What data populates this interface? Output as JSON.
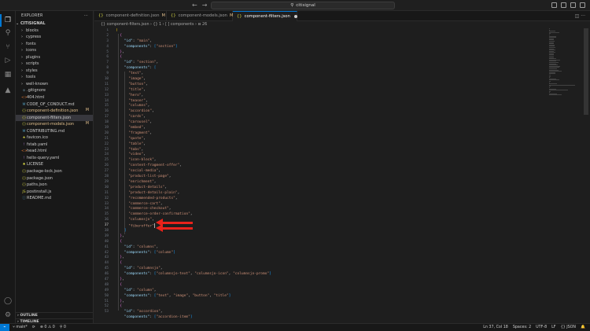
{
  "titlebar": {
    "back_icon": "arrow-left-icon",
    "forward_icon": "arrow-right-icon",
    "search_text": "citisignal"
  },
  "sidebar": {
    "title": "EXPLORER",
    "more": "···",
    "root": "CITISIGNAL",
    "items": [
      {
        "label": "blocks",
        "type": "folder"
      },
      {
        "label": "cypress",
        "type": "folder"
      },
      {
        "label": "fonts",
        "type": "folder"
      },
      {
        "label": "icons",
        "type": "folder"
      },
      {
        "label": "plugins",
        "type": "folder"
      },
      {
        "label": "scripts",
        "type": "folder"
      },
      {
        "label": "styles",
        "type": "folder"
      },
      {
        "label": "tools",
        "type": "folder"
      },
      {
        "label": "well-known",
        "type": "folder"
      },
      {
        "label": ".gitignore",
        "type": "file",
        "icon": "◆"
      },
      {
        "label": "404.html",
        "type": "file",
        "icon": "<>"
      },
      {
        "label": "CODE_OF_CONDUCT.md",
        "type": "file",
        "icon": "M"
      },
      {
        "label": "component-definition.json",
        "type": "file",
        "icon": "{}",
        "badge": "M"
      },
      {
        "label": "component-filters.json",
        "type": "file",
        "icon": "{}",
        "selected": true
      },
      {
        "label": "component-models.json",
        "type": "file",
        "icon": "{}",
        "badge": "M"
      },
      {
        "label": "CONTRIBUTING.md",
        "type": "file",
        "icon": "M"
      },
      {
        "label": "favicon.ico",
        "type": "file",
        "icon": "★"
      },
      {
        "label": "fstab.yaml",
        "type": "file",
        "icon": "!"
      },
      {
        "label": "head.html",
        "type": "file",
        "icon": "<>"
      },
      {
        "label": "helix-query.yaml",
        "type": "file",
        "icon": "!"
      },
      {
        "label": "LICENSE",
        "type": "file",
        "icon": "♠"
      },
      {
        "label": "package-lock.json",
        "type": "file",
        "icon": "{}"
      },
      {
        "label": "package.json",
        "type": "file",
        "icon": "{}"
      },
      {
        "label": "paths.json",
        "type": "file",
        "icon": "{}"
      },
      {
        "label": "postinstall.js",
        "type": "file",
        "icon": "JS"
      },
      {
        "label": "README.md",
        "type": "file",
        "icon": "ⓘ"
      }
    ],
    "outline": "OUTLINE",
    "timeline": "TIMELINE"
  },
  "tabs": [
    {
      "label": "component-definition.json",
      "status": "M"
    },
    {
      "label": "component-models.json",
      "status": "M"
    },
    {
      "label": "component-filters.json",
      "status": "",
      "active": true,
      "dirty": true
    }
  ],
  "breadcrumb": "{} component-filters.json  ›  {} 1  ›  [ ] components  ›  ⊟ 26",
  "editor": {
    "line_numbers": [
      "1",
      "2",
      "3",
      "4",
      "5",
      "6",
      "7",
      "8",
      "9",
      "10",
      "11",
      "12",
      "13",
      "14",
      "15",
      "16",
      "17",
      "18",
      "19",
      "20",
      "21",
      "22",
      "23",
      "24",
      "25",
      "26",
      "27",
      "28",
      "29",
      "30",
      "31",
      "32",
      "33",
      "34",
      "35",
      "36",
      "37",
      "38",
      "39",
      "40",
      "41",
      "42",
      "43",
      "44",
      "45",
      "46",
      "47",
      "48",
      "49",
      "50",
      "51",
      "52",
      "53"
    ],
    "lines": [
      [
        [
          "b1",
          "["
        ]
      ],
      [
        [
          "p",
          "  "
        ],
        [
          "b2",
          "{"
        ]
      ],
      [
        [
          "p",
          "    "
        ],
        [
          "k",
          "\"id\""
        ],
        [
          "p",
          ": "
        ],
        [
          "s",
          "\"main\""
        ],
        [
          "p",
          ","
        ]
      ],
      [
        [
          "p",
          "    "
        ],
        [
          "k",
          "\"components\""
        ],
        [
          "p",
          ": "
        ],
        [
          "b3",
          "["
        ],
        [
          "s",
          "\"section\""
        ],
        [
          "b3",
          "]"
        ]
      ],
      [
        [
          "p",
          "  "
        ],
        [
          "b2",
          "}"
        ],
        [
          "p",
          ","
        ]
      ],
      [
        [
          "p",
          "  "
        ],
        [
          "b2",
          "{"
        ]
      ],
      [
        [
          "p",
          "    "
        ],
        [
          "k",
          "\"id\""
        ],
        [
          "p",
          ": "
        ],
        [
          "s",
          "\"section\""
        ],
        [
          "p",
          ","
        ]
      ],
      [
        [
          "p",
          "    "
        ],
        [
          "k",
          "\"components\""
        ],
        [
          "p",
          ": "
        ],
        [
          "b3",
          "["
        ]
      ],
      [
        [
          "p",
          "      "
        ],
        [
          "s",
          "\"text\""
        ],
        [
          "p",
          ","
        ]
      ],
      [
        [
          "p",
          "      "
        ],
        [
          "s",
          "\"image\""
        ],
        [
          "p",
          ","
        ]
      ],
      [
        [
          "p",
          "      "
        ],
        [
          "s",
          "\"button\""
        ],
        [
          "p",
          ","
        ]
      ],
      [
        [
          "p",
          "      "
        ],
        [
          "s",
          "\"title\""
        ],
        [
          "p",
          ","
        ]
      ],
      [
        [
          "p",
          "      "
        ],
        [
          "s",
          "\"hero\""
        ],
        [
          "p",
          ","
        ]
      ],
      [
        [
          "p",
          "      "
        ],
        [
          "s",
          "\"teaser\""
        ],
        [
          "p",
          ","
        ]
      ],
      [
        [
          "p",
          "      "
        ],
        [
          "s",
          "\"columns\""
        ],
        [
          "p",
          ","
        ]
      ],
      [
        [
          "p",
          "      "
        ],
        [
          "s",
          "\"accordion\""
        ],
        [
          "p",
          ","
        ]
      ],
      [
        [
          "p",
          "      "
        ],
        [
          "s",
          "\"cards\""
        ],
        [
          "p",
          ","
        ]
      ],
      [
        [
          "p",
          "      "
        ],
        [
          "s",
          "\"carousel\""
        ],
        [
          "p",
          ","
        ]
      ],
      [
        [
          "p",
          "      "
        ],
        [
          "s",
          "\"embed\""
        ],
        [
          "p",
          ","
        ]
      ],
      [
        [
          "p",
          "      "
        ],
        [
          "s",
          "\"fragment\""
        ],
        [
          "p",
          ","
        ]
      ],
      [
        [
          "p",
          "      "
        ],
        [
          "s",
          "\"quote\""
        ],
        [
          "p",
          ","
        ]
      ],
      [
        [
          "p",
          "      "
        ],
        [
          "s",
          "\"table\""
        ],
        [
          "p",
          ","
        ]
      ],
      [
        [
          "p",
          "      "
        ],
        [
          "s",
          "\"tabs\""
        ],
        [
          "p",
          ","
        ]
      ],
      [
        [
          "p",
          "      "
        ],
        [
          "s",
          "\"video\""
        ],
        [
          "p",
          ","
        ]
      ],
      [
        [
          "p",
          "      "
        ],
        [
          "s",
          "\"icon-block\""
        ],
        [
          "p",
          ","
        ]
      ],
      [
        [
          "p",
          "      "
        ],
        [
          "s",
          "\"content-fragment-offer\""
        ],
        [
          "p",
          ","
        ]
      ],
      [
        [
          "p",
          "      "
        ],
        [
          "s",
          "\"social-media\""
        ],
        [
          "p",
          ","
        ]
      ],
      [
        [
          "p",
          "      "
        ],
        [
          "s",
          "\"product-list-page\""
        ],
        [
          "p",
          ","
        ]
      ],
      [
        [
          "p",
          "      "
        ],
        [
          "s",
          "\"enrichment\""
        ],
        [
          "p",
          ","
        ]
      ],
      [
        [
          "p",
          "      "
        ],
        [
          "s",
          "\"product-details\""
        ],
        [
          "p",
          ","
        ]
      ],
      [
        [
          "p",
          "      "
        ],
        [
          "s",
          "\"product-details-plain\""
        ],
        [
          "p",
          ","
        ]
      ],
      [
        [
          "p",
          "      "
        ],
        [
          "s",
          "\"recommended-products\""
        ],
        [
          "p",
          ","
        ]
      ],
      [
        [
          "p",
          "      "
        ],
        [
          "s",
          "\"commerce-cart\""
        ],
        [
          "p",
          ","
        ]
      ],
      [
        [
          "p",
          "      "
        ],
        [
          "s",
          "\"commerce-checkout\""
        ],
        [
          "p",
          ","
        ]
      ],
      [
        [
          "p",
          "      "
        ],
        [
          "s",
          "\"commerce-order-confirmation\""
        ],
        [
          "p",
          ","
        ]
      ],
      [
        [
          "p",
          "      "
        ],
        [
          "s",
          "\"columnsjo\""
        ],
        [
          "p",
          ","
        ]
      ],
      [
        [
          "p",
          "      "
        ],
        [
          "s",
          "\"fiberoffer\""
        ],
        [
          "cursor",
          ""
        ]
      ],
      [
        [
          "p",
          "    "
        ],
        [
          "b3",
          "]"
        ]
      ],
      [
        [
          "p",
          "  "
        ],
        [
          "b2",
          "}"
        ],
        [
          "p",
          ","
        ]
      ],
      [
        [
          "p",
          "  "
        ],
        [
          "b2",
          "{"
        ]
      ],
      [
        [
          "p",
          "    "
        ],
        [
          "k",
          "\"id\""
        ],
        [
          "p",
          ": "
        ],
        [
          "s",
          "\"columns\""
        ],
        [
          "p",
          ","
        ]
      ],
      [
        [
          "p",
          "    "
        ],
        [
          "k",
          "\"components\""
        ],
        [
          "p",
          ": "
        ],
        [
          "b3",
          "["
        ],
        [
          "s",
          "\"column\""
        ],
        [
          "b3",
          "]"
        ]
      ],
      [
        [
          "p",
          "  "
        ],
        [
          "b2",
          "}"
        ],
        [
          "p",
          ","
        ]
      ],
      [
        [
          "p",
          "  "
        ],
        [
          "b2",
          "{"
        ]
      ],
      [
        [
          "p",
          "    "
        ],
        [
          "k",
          "\"id\""
        ],
        [
          "p",
          ": "
        ],
        [
          "s",
          "\"columnsjo\""
        ],
        [
          "p",
          ","
        ]
      ],
      [
        [
          "p",
          "    "
        ],
        [
          "k",
          "\"components\""
        ],
        [
          "p",
          ": "
        ],
        [
          "b3",
          "["
        ],
        [
          "s",
          "\"columnsjo-text\""
        ],
        [
          "p",
          ", "
        ],
        [
          "s",
          "\"columnsjo-icon\""
        ],
        [
          "p",
          ", "
        ],
        [
          "s",
          "\"columnsjo-promo\""
        ],
        [
          "b3",
          "]"
        ]
      ],
      [
        [
          "p",
          "  "
        ],
        [
          "b2",
          "}"
        ],
        [
          "p",
          ","
        ]
      ],
      [
        [
          "p",
          "  "
        ],
        [
          "b2",
          "{"
        ]
      ],
      [
        [
          "p",
          "    "
        ],
        [
          "k",
          "\"id\""
        ],
        [
          "p",
          ": "
        ],
        [
          "s",
          "\"column\""
        ],
        [
          "p",
          ","
        ]
      ],
      [
        [
          "p",
          "    "
        ],
        [
          "k",
          "\"components\""
        ],
        [
          "p",
          ": "
        ],
        [
          "b3",
          "["
        ],
        [
          "s",
          "\"text\""
        ],
        [
          "p",
          ", "
        ],
        [
          "s",
          "\"image\""
        ],
        [
          "p",
          ", "
        ],
        [
          "s",
          "\"button\""
        ],
        [
          "p",
          ", "
        ],
        [
          "s",
          "\"title\""
        ],
        [
          "b3",
          "]"
        ]
      ],
      [
        [
          "p",
          "  "
        ],
        [
          "b2",
          "}"
        ],
        [
          "p",
          ","
        ]
      ],
      [
        [
          "p",
          "  "
        ],
        [
          "b2",
          "{"
        ]
      ],
      [
        [
          "p",
          "    "
        ],
        [
          "k",
          "\"id\""
        ],
        [
          "p",
          ": "
        ],
        [
          "s",
          "\"accordion\""
        ],
        [
          "p",
          ","
        ]
      ],
      [
        [
          "p",
          "    "
        ],
        [
          "k",
          "\"components\""
        ],
        [
          "p",
          ": "
        ],
        [
          "b3",
          "["
        ],
        [
          "s",
          "\"accordion-item\""
        ],
        [
          "b3",
          "]"
        ]
      ]
    ]
  },
  "statusbar": {
    "branch": "main*",
    "sync": "⟳",
    "problems": "⊗ 0 ⚠ 0",
    "ports": "⚲ 0",
    "position": "Ln 37, Col 18",
    "spaces": "Spaces: 2",
    "encoding": "UTF-8",
    "eol": "LF",
    "language": "{} JSON",
    "bell": "🔔"
  },
  "colors": {
    "accent": "#0078d4",
    "arrow": "#e8231b",
    "modified": "#e2c08d"
  }
}
